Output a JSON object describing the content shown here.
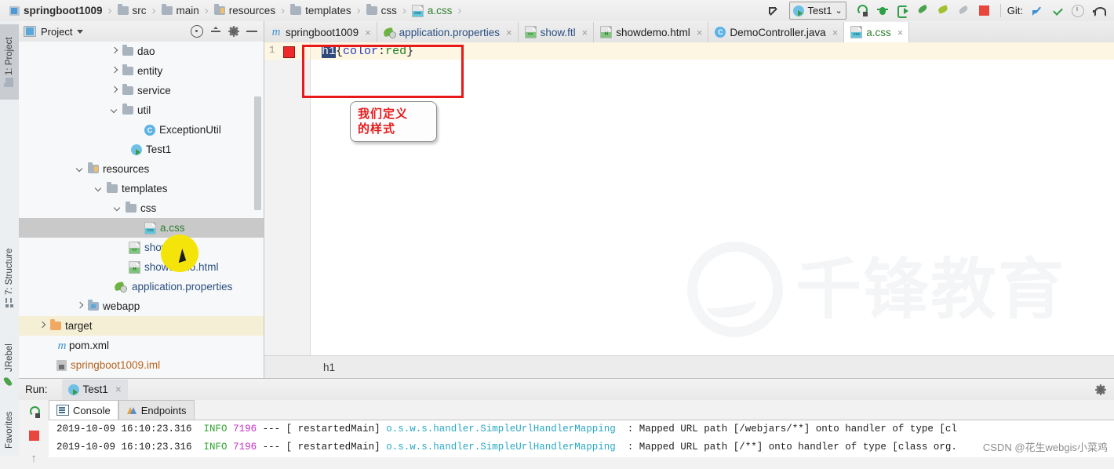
{
  "breadcrumb": {
    "items": [
      {
        "label": "springboot1009",
        "icon": "module-icon"
      },
      {
        "label": "src",
        "icon": "folder-icon"
      },
      {
        "label": "main",
        "icon": "folder-icon"
      },
      {
        "label": "resources",
        "icon": "resources-folder-icon"
      },
      {
        "label": "templates",
        "icon": "folder-icon"
      },
      {
        "label": "css",
        "icon": "folder-icon"
      },
      {
        "label": "a.css",
        "icon": "css-file-icon"
      }
    ],
    "separator": "›"
  },
  "toolbar": {
    "back_icon": "navigate-back-icon",
    "run_configuration": "Test1",
    "run_config_dropdown": "⌄",
    "run_icon": "run-icon",
    "debug_icon": "debug-icon",
    "run_coverage_icon": "run-with-coverage-icon",
    "jrebel_run_icon": "jrebel-run-icon",
    "jrebel_debug_icon": "jrebel-debug-icon",
    "jrebel_disabled_icon": "jrebel-disabled-icon",
    "stop_icon": "stop-icon",
    "git_label": "Git:",
    "git_update_icon": "git-update-project-icon",
    "git_commit_icon": "git-commit-icon",
    "git_history_icon": "git-history-icon",
    "git_rollback_icon": "git-rollback-icon"
  },
  "tool_windows": {
    "left": [
      {
        "label": "1: Project",
        "icon": "project-icon",
        "selected": true
      },
      {
        "label": "7: Structure",
        "icon": "structure-icon",
        "selected": false
      },
      {
        "label": "JRebel",
        "icon": "jrebel-icon",
        "selected": false
      },
      {
        "label": "Favorites",
        "icon": "favorites-icon",
        "selected": false
      }
    ]
  },
  "project_panel": {
    "title": "Project",
    "dropdown_icon": "chevron-down-icon",
    "locate_icon": "locate-icon",
    "collapse_icon": "collapse-all-icon",
    "settings_icon": "gear-icon",
    "hide_icon": "minimize-icon",
    "tree": [
      {
        "label": "dao",
        "icon": "folder-icon",
        "indent": 4,
        "arrow": "right",
        "state": "normal"
      },
      {
        "label": "entity",
        "icon": "folder-icon",
        "indent": 4,
        "arrow": "right",
        "state": "normal"
      },
      {
        "label": "service",
        "icon": "folder-icon",
        "indent": 4,
        "arrow": "right",
        "state": "normal"
      },
      {
        "label": "util",
        "icon": "folder-icon",
        "indent": 4,
        "arrow": "down",
        "state": "normal"
      },
      {
        "label": "ExceptionUtil",
        "icon": "java-class-icon",
        "indent": 6,
        "arrow": "none",
        "state": "normal"
      },
      {
        "label": "Test1",
        "icon": "java-runnable-class-icon",
        "indent": 5,
        "arrow": "none",
        "state": "normal"
      },
      {
        "label": "resources",
        "icon": "resources-folder-icon",
        "indent": 3,
        "arrow": "down",
        "state": "normal"
      },
      {
        "label": "templates",
        "icon": "folder-icon",
        "indent": 4,
        "arrow": "down",
        "state": "normal"
      },
      {
        "label": "css",
        "icon": "folder-icon",
        "indent": 5,
        "arrow": "down",
        "state": "normal"
      },
      {
        "label": "a.css",
        "icon": "css-file-icon",
        "indent": 6,
        "arrow": "none",
        "state": "selected"
      },
      {
        "label": "show.ftl",
        "icon": "ftl-file-icon",
        "indent": 6,
        "arrow": "none",
        "state": "normal"
      },
      {
        "label": "showdemo.html",
        "icon": "html-file-icon",
        "indent": 6,
        "arrow": "none",
        "state": "normal"
      },
      {
        "label": "application.properties",
        "icon": "spring-properties-icon",
        "indent": 5,
        "arrow": "none",
        "state": "normal"
      },
      {
        "label": "webapp",
        "icon": "webapp-folder-icon",
        "indent": 4,
        "arrow": "right",
        "state": "normal"
      },
      {
        "label": "target",
        "icon": "target-folder-icon",
        "indent": 2,
        "arrow": "right",
        "state": "highlighted"
      },
      {
        "label": "pom.xml",
        "icon": "maven-icon",
        "indent": 3,
        "arrow": "none",
        "state": "normal"
      },
      {
        "label": "springboot1009.iml",
        "icon": "iml-file-icon",
        "indent": 3,
        "arrow": "none",
        "state": "normal"
      }
    ]
  },
  "editor": {
    "tabs": [
      {
        "label": "springboot1009",
        "icon": "maven-icon",
        "active": false,
        "close": "×"
      },
      {
        "label": "application.properties",
        "icon": "spring-properties-icon",
        "active": false,
        "close": "×"
      },
      {
        "label": "show.ftl",
        "icon": "ftl-file-icon",
        "active": false,
        "close": "×"
      },
      {
        "label": "showdemo.html",
        "icon": "html-file-icon",
        "active": false,
        "close": "×"
      },
      {
        "label": "DemoController.java",
        "icon": "java-class-icon",
        "active": false,
        "close": "×"
      },
      {
        "label": "a.css",
        "icon": "css-file-icon",
        "active": true,
        "close": "×"
      }
    ],
    "line_number": "1",
    "color_swatch": "#ef2929",
    "code": {
      "selector": "h1",
      "open_brace": "{",
      "property": "color",
      "colon": ":",
      "value": "red",
      "close_brace": "}"
    },
    "breadcrumb_bottom": "h1",
    "watermark": "千锋教育"
  },
  "annotation": {
    "callout_line1": "我们定义",
    "callout_line2": "的样式",
    "highlight_color": "#e8191a"
  },
  "run_panel": {
    "run_label": "Run:",
    "tab_label": "Test1",
    "tab_close": "×",
    "settings_icon": "gear-icon",
    "rerun_icon": "rerun-icon",
    "stop_icon": "stop-icon",
    "scroll_up_icon": "scroll-up-icon",
    "sub_tabs": [
      {
        "label": "Console",
        "icon": "console-icon",
        "active": true
      },
      {
        "label": "Endpoints",
        "icon": "endpoints-icon",
        "active": false
      }
    ],
    "log_lines": [
      {
        "date": "2019-10-09 16:10:23.316",
        "level": "INFO",
        "pid": "7196",
        "dashes": "---",
        "thread": "[  restartedMain]",
        "logger": "o.s.w.s.handler.SimpleUrlHandlerMapping",
        "message": ": Mapped URL path [/webjars/**] onto handler of type [cl"
      },
      {
        "date": "2019-10-09 16:10:23.316",
        "level": "INFO",
        "pid": "7196",
        "dashes": "---",
        "thread": "[  restartedMain]",
        "logger": "o.s.w.s.handler.SimpleUrlHandlerMapping",
        "message": ": Mapped URL path [/**] onto handler of type [class org."
      }
    ],
    "watermark": "CSDN @花生webgis小菜鸡"
  }
}
